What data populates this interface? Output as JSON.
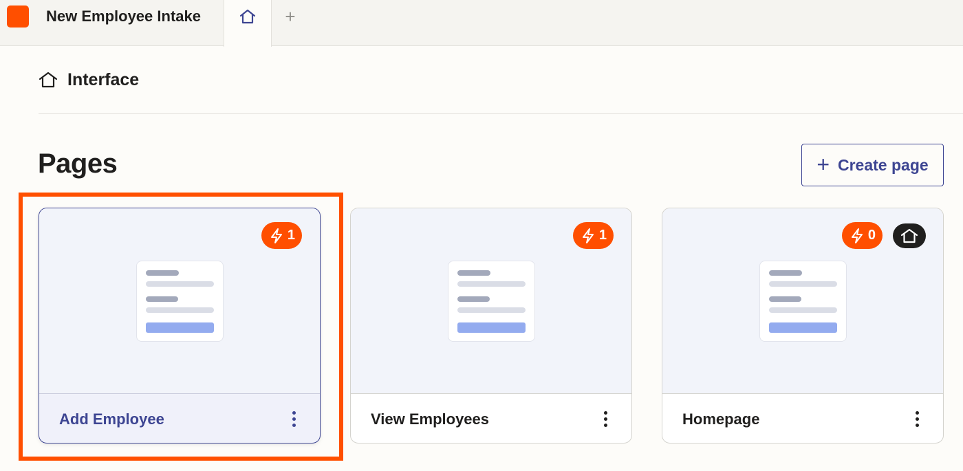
{
  "app": {
    "title": "New Employee Intake",
    "brand_color": "#ff4f00",
    "logo_icon": "app-logo-square",
    "add_tab_label": "+"
  },
  "header": {
    "icon": "home-outline-icon",
    "title": "Interface"
  },
  "pages_section": {
    "title": "Pages",
    "create_button": {
      "icon": "plus-icon",
      "label": "Create page"
    }
  },
  "cards": [
    {
      "name": "Add Employee",
      "zaps": "1",
      "selected": true,
      "is_homepage": false
    },
    {
      "name": "View Employees",
      "zaps": "1",
      "selected": false,
      "is_homepage": false
    },
    {
      "name": "Homepage",
      "zaps": "0",
      "selected": false,
      "is_homepage": true
    }
  ],
  "colors": {
    "accent": "#3d4592",
    "zap_badge": "#ff4f00",
    "home_badge": "#201f1e",
    "highlight": "#ff4f00"
  }
}
